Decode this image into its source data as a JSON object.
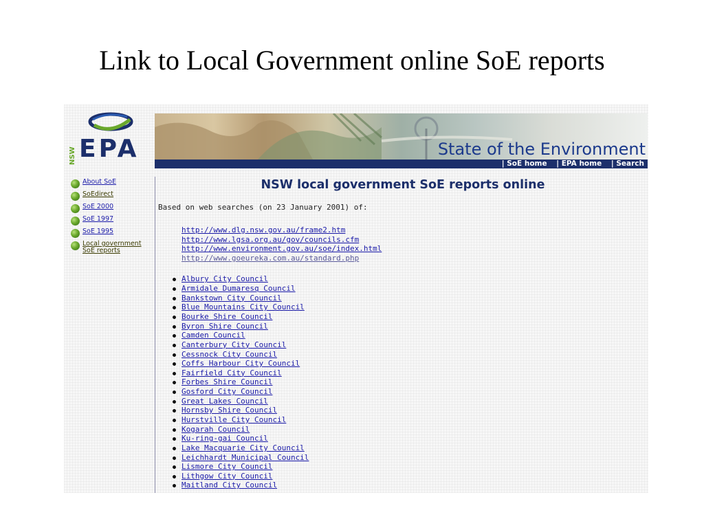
{
  "slide": {
    "title": "Link to Local Government online SoE reports"
  },
  "logo": {
    "nsw": "NSW",
    "epa": "EPA"
  },
  "banner": {
    "title": "State of the Environment"
  },
  "nav": {
    "items": [
      "| SoE home",
      "| EPA home",
      "| Search"
    ]
  },
  "sidebar": {
    "items": [
      {
        "label": "About SoE"
      },
      {
        "label": "SoEdirect"
      },
      {
        "label": "SoE 2000"
      },
      {
        "label": "SoE 1997"
      },
      {
        "label": "SoE 1995"
      },
      {
        "label": "Local government SoE reports"
      }
    ]
  },
  "main": {
    "heading": "NSW local government SoE reports online",
    "intro": "Based on web searches (on 23 January 2001) of:",
    "urls": [
      "http://www.dlg.nsw.gov.au/frame2.htm",
      "http://www.lgsa.org.au/gov/councils.cfm",
      "http://www.environment.gov.au/soe/index.html",
      "http://www.goeureka.com.au/standard.php"
    ],
    "councils": [
      "Albury City Council",
      "Armidale Dumaresq Council",
      "Bankstown City Council",
      "Blue Mountains City Council",
      "Bourke Shire Council",
      "Byron Shire Council",
      "Camden Council",
      "Canterbury City Council",
      "Cessnock City Council",
      "Coffs Harbour City Council",
      "Fairfield City Council",
      "Forbes Shire Council",
      "Gosford City Council",
      "Great Lakes Council",
      "Hornsby Shire Council",
      "Hurstville City Council",
      "Kogarah Council",
      "Ku-ring-gai Council",
      "Lake Macquarie City Council",
      "Leichhardt Municipal Council",
      "Lismore City Council",
      "Lithgow City Council",
      "Maitland City Council"
    ]
  },
  "colors": {
    "brand_navy": "#1c2f6b",
    "link_blue": "#1a1aa8",
    "bullet_green": "#6aa82c"
  }
}
